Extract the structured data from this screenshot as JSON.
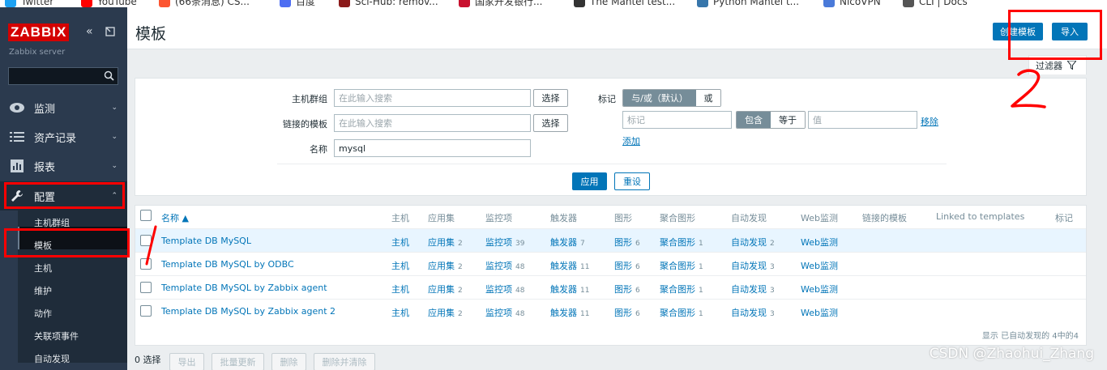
{
  "bookmarks": [
    {
      "label": "Twitter",
      "icon": "twitter-icon",
      "color": "#1da1f2"
    },
    {
      "label": "YouTube",
      "icon": "youtube-icon",
      "color": "#ff0000"
    },
    {
      "label": "(66条消息) CS...",
      "icon": "csdn-icon",
      "color": "#fc5531"
    },
    {
      "label": "百度",
      "icon": "baidu-icon",
      "color": "#4e6ef2"
    },
    {
      "label": "Sci-Hub: remov...",
      "icon": "scihub-icon",
      "color": "#8b1a1a"
    },
    {
      "label": "国家开发银行...",
      "icon": "cdb-icon",
      "color": "#c8102e"
    },
    {
      "label": "The Mantel test...",
      "icon": "github-icon",
      "color": "#333333"
    },
    {
      "label": "Python Mantel t...",
      "icon": "python-icon",
      "color": "#3776ab"
    },
    {
      "label": "NicoVPN",
      "icon": "vpn-icon",
      "color": "#4a7ad9"
    },
    {
      "label": "CLI | Docs",
      "icon": "docs-icon",
      "color": "#555555"
    }
  ],
  "sidebar": {
    "logo": "ZABBIX",
    "server": "Zabbix server",
    "collapse_icon": "«",
    "menu": [
      {
        "label": "监测",
        "icon": "eye-icon"
      },
      {
        "label": "资产记录",
        "icon": "list-icon"
      },
      {
        "label": "报表",
        "icon": "chart-icon"
      },
      {
        "label": "配置",
        "icon": "wrench-icon"
      }
    ],
    "submenu": [
      "主机群组",
      "模板",
      "主机",
      "维护",
      "动作",
      "关联项事件",
      "自动发现"
    ]
  },
  "header": {
    "title": "模板",
    "create_button": "创建模板",
    "import_button": "导入",
    "filter_tab": "过滤器"
  },
  "filter": {
    "host_groups_label": "主机群组",
    "host_groups_placeholder": "在此输入搜索",
    "select_label": "选择",
    "linked_templates_label": "链接的模板",
    "linked_templates_placeholder": "在此输入搜索",
    "name_label": "名称",
    "name_value": "mysql",
    "tags_label": "标记",
    "and_or_label": "与/或（默认）",
    "or_label": "或",
    "tag_placeholder": "标记",
    "contains_label": "包含",
    "equals_label": "等于",
    "value_placeholder": "值",
    "remove_label": "移除",
    "add_label": "添加",
    "apply_label": "应用",
    "reset_label": "重设"
  },
  "table": {
    "headers": [
      "名称 ▲",
      "主机",
      "应用集",
      "监控项",
      "触发器",
      "图形",
      "聚合图形",
      "自动发现",
      "Web监测",
      "链接的模板",
      "Linked to templates",
      "标记"
    ],
    "rows": [
      {
        "name": "Template DB MySQL",
        "hosts": "主机",
        "apps": "应用集",
        "apps_n": "2",
        "items": "监控项",
        "items_n": "39",
        "triggers": "触发器",
        "triggers_n": "7",
        "graphs": "图形",
        "graphs_n": "6",
        "screens": "聚合图形",
        "screens_n": "1",
        "discovery": "自动发现",
        "discovery_n": "2",
        "web": "Web监测"
      },
      {
        "name": "Template DB MySQL by ODBC",
        "hosts": "主机",
        "apps": "应用集",
        "apps_n": "2",
        "items": "监控项",
        "items_n": "48",
        "triggers": "触发器",
        "triggers_n": "11",
        "graphs": "图形",
        "graphs_n": "6",
        "screens": "聚合图形",
        "screens_n": "1",
        "discovery": "自动发现",
        "discovery_n": "3",
        "web": "Web监测"
      },
      {
        "name": "Template DB MySQL by Zabbix agent",
        "hosts": "主机",
        "apps": "应用集",
        "apps_n": "2",
        "items": "监控项",
        "items_n": "48",
        "triggers": "触发器",
        "triggers_n": "11",
        "graphs": "图形",
        "graphs_n": "6",
        "screens": "聚合图形",
        "screens_n": "1",
        "discovery": "自动发现",
        "discovery_n": "3",
        "web": "Web监测"
      },
      {
        "name": "Template DB MySQL by Zabbix agent 2",
        "hosts": "主机",
        "apps": "应用集",
        "apps_n": "2",
        "items": "监控项",
        "items_n": "48",
        "triggers": "触发器",
        "triggers_n": "11",
        "graphs": "图形",
        "graphs_n": "6",
        "screens": "聚合图形",
        "screens_n": "1",
        "discovery": "自动发现",
        "discovery_n": "3",
        "web": "Web监测"
      }
    ],
    "footer": "显示 已自动发现的 4中的4"
  },
  "bulk": {
    "selected": "0 选择",
    "export": "导出",
    "mass_update": "批量更新",
    "delete": "删除",
    "delete_clear": "删除并清除"
  },
  "annotations": {
    "mark_1": "/",
    "mark_2": "2",
    "color": "#ff0000"
  },
  "watermark": "CSDN @Zhaohui_Zhang"
}
